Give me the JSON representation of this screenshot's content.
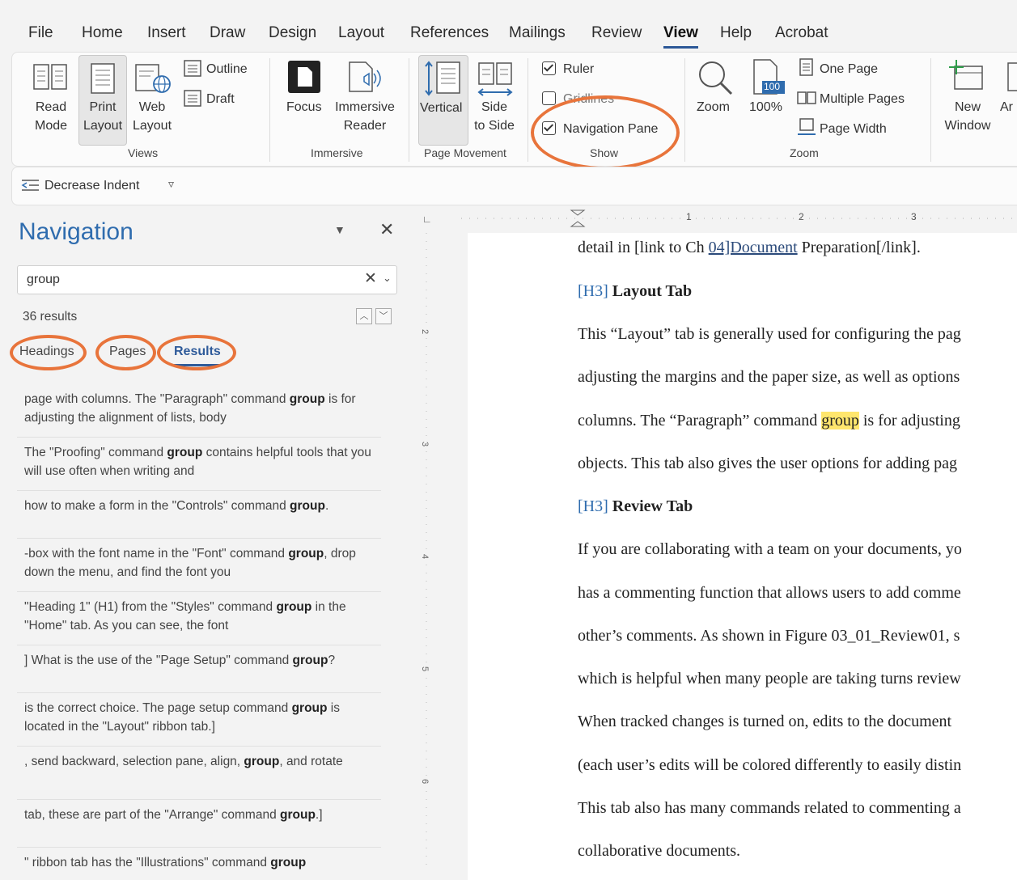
{
  "menu": [
    "File",
    "Home",
    "Insert",
    "Draw",
    "Design",
    "Layout",
    "References",
    "Mailings",
    "Review",
    "View",
    "Help",
    "Acrobat"
  ],
  "ribbon": {
    "views": {
      "read": [
        "Read",
        "Mode"
      ],
      "print": [
        "Print",
        "Layout"
      ],
      "web": [
        "Web",
        "Layout"
      ],
      "outline": "Outline",
      "draft": "Draft",
      "group": "Views"
    },
    "immersive": {
      "focus": "Focus",
      "reader": [
        "Immersive",
        "Reader"
      ],
      "group": "Immersive"
    },
    "movement": {
      "vertical": "Vertical",
      "side": [
        "Side",
        "to Side"
      ],
      "group": "Page Movement"
    },
    "show": {
      "ruler": "Ruler",
      "gridlines": "Gridlines",
      "nav_pane": "Navigation Pane",
      "group": "Show",
      "ruler_checked": true,
      "gridlines_checked": false,
      "nav_pane_checked": true
    },
    "zoom": {
      "zoom": "Zoom",
      "percent": "100%",
      "percent_icon": "100",
      "one_page": "One Page",
      "multi_pages": "Multiple Pages",
      "page_width": "Page Width",
      "group": "Zoom"
    },
    "window": {
      "new": [
        "New",
        "Window"
      ],
      "arrange": "Ar"
    }
  },
  "qab": {
    "decrease_indent": "Decrease Indent"
  },
  "navigation": {
    "title": "Navigation",
    "search_value": "group",
    "results_count": "36 results",
    "tabs": [
      "Headings",
      "Pages",
      "Results"
    ],
    "active_tab": "Results",
    "results": [
      {
        "pre": "page with columns. The \"Paragraph\" command ",
        "hit": "group",
        "post": " is for adjusting the alignment of lists, body"
      },
      {
        "pre": "The \"Proofing\" command ",
        "hit": "group",
        "post": " contains helpful tools that you will use often when writing and"
      },
      {
        "pre": "how to make a form in the \"Controls\" command ",
        "hit": "group",
        "post": "."
      },
      {
        "pre": "-box with the font name in the \"Font\" command ",
        "hit": "group",
        "post": ", drop down the menu, and find the font you"
      },
      {
        "pre": "\"Heading 1\" (H1) from the \"Styles\" command ",
        "hit": "group",
        "post": " in the \"Home\" tab. As you can see, the font"
      },
      {
        "pre": "] What is the use of the \"Page Setup\" command ",
        "hit": "group",
        "post": "?"
      },
      {
        "pre": "is the correct choice. The page setup command ",
        "hit": "group",
        "post": " is located in the \"Layout\" ribbon tab.]"
      },
      {
        "pre": ", send backward, selection pane, align, ",
        "hit": "group",
        "post": ", and rotate"
      },
      {
        "pre": "tab, these are part of the \"Arrange\" command ",
        "hit": "group",
        "post": ".]"
      },
      {
        "pre": "\" ribbon tab has the \"Illustrations\" command ",
        "hit": "group",
        "post": ""
      }
    ]
  },
  "ruler": {
    "h_numbers": [
      "1",
      "2",
      "3"
    ],
    "v_numbers": [
      "2",
      "3",
      "4",
      "5",
      "6"
    ]
  },
  "document": {
    "line1_pre": "detail in [link to Ch ",
    "line1_link": "04]Document",
    "line1_post": " Preparation[/link].",
    "h3_tag": "[H3]",
    "heading1": "Layout Tab",
    "para1": [
      "This “Layout” tab is generally used for configuring the pag",
      "adjusting the margins and the paper size, as well as options"
    ],
    "para1_l3_pre": "columns. The “Paragraph” command ",
    "para1_l3_hit": "group",
    "para1_l3_post": " is for adjusting",
    "para1_l4": "objects. This tab also gives the user options for adding pag",
    "heading2": "Review Tab",
    "para2": [
      "If you are collaborating with a team on your documents, yo",
      "has a commenting function that allows users to add comme",
      "other’s comments. As shown in Figure 03_01_Review01, s",
      "which is helpful when many people are taking turns review",
      "When tracked changes is turned on, edits to the document",
      "(each user’s edits will be colored differently to easily distin",
      "This tab also has many commands related to commenting a",
      "collaborative documents."
    ]
  },
  "colors": {
    "accent": "#2f6cae",
    "highlight_circle": "#e8743b",
    "search_highlight": "#ffe66d"
  }
}
